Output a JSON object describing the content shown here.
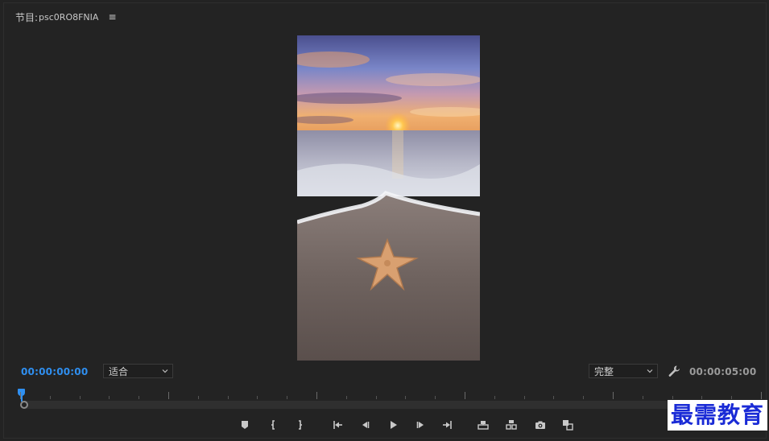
{
  "panel": {
    "title_prefix": "节目:",
    "sequence_name": "psc0RO8FNIA",
    "menu_glyph": "≡"
  },
  "timecode": {
    "current": "00:00:00:00",
    "duration": "00:00:05:00"
  },
  "fit_select": {
    "value": "适合"
  },
  "quality_select": {
    "value": "完整"
  },
  "controls": [
    {
      "name": "add-marker-button",
      "icon": "marker-icon"
    },
    {
      "name": "mark-in-button",
      "icon": "mark-in-icon"
    },
    {
      "name": "mark-out-button",
      "icon": "mark-out-icon"
    },
    {
      "name": "go-to-in-button",
      "icon": "go-to-in-icon"
    },
    {
      "name": "step-back-button",
      "icon": "step-back-icon"
    },
    {
      "name": "play-button",
      "icon": "play-icon"
    },
    {
      "name": "step-forward-button",
      "icon": "step-forward-icon"
    },
    {
      "name": "go-to-out-button",
      "icon": "go-to-out-icon"
    },
    {
      "name": "lift-button",
      "icon": "lift-icon"
    },
    {
      "name": "extract-button",
      "icon": "extract-icon"
    },
    {
      "name": "export-frame-button",
      "icon": "camera-icon"
    },
    {
      "name": "comparison-view-button",
      "icon": "comparison-icon"
    }
  ],
  "colors": {
    "accent": "#2f8ff0",
    "background": "#232323",
    "watermark": "#1a2bd6"
  },
  "watermark": {
    "text": "最需教育"
  }
}
